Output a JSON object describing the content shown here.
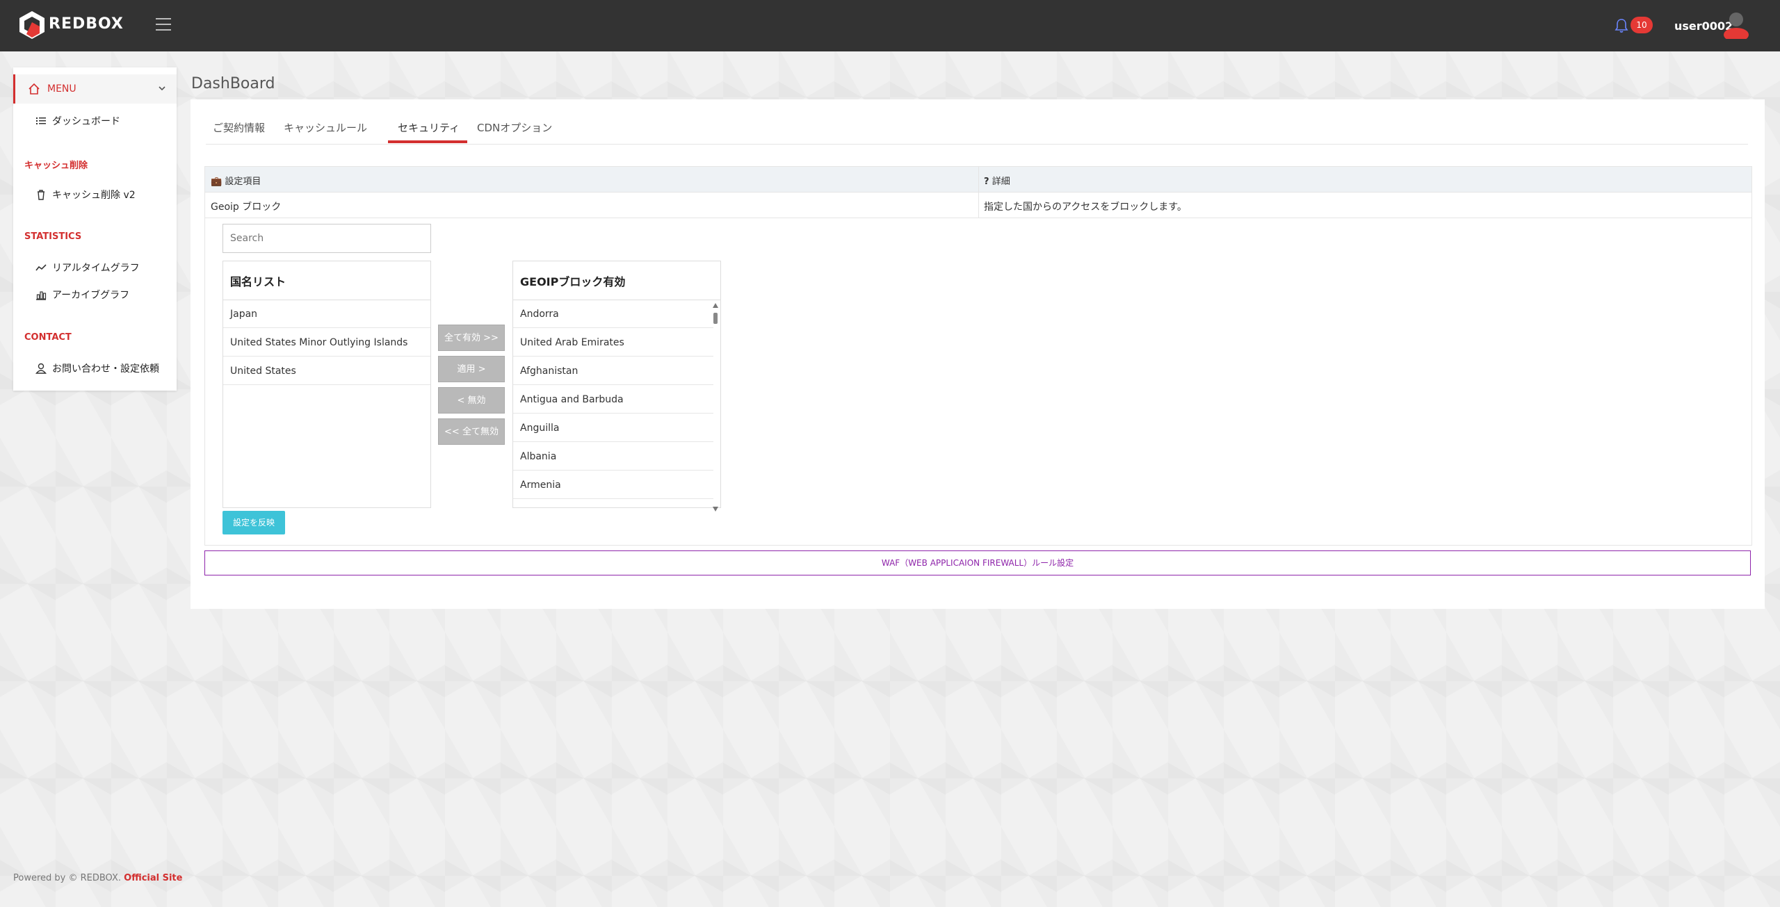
{
  "header": {
    "logo_text": "REDBOX",
    "notification_count": "10",
    "username": "user0002"
  },
  "sidebar": {
    "menu_label": "MENU",
    "items": [
      {
        "label": "ダッシュボード"
      },
      {
        "section": "キャッシュ削除"
      },
      {
        "label": "キャッシュ削除 v2"
      },
      {
        "section": "STATISTICS"
      },
      {
        "label": "リアルタイムグラフ"
      },
      {
        "label": "アーカイブグラフ"
      },
      {
        "section": "CONTACT"
      },
      {
        "label": "お問い合わせ・設定依頼"
      }
    ]
  },
  "main": {
    "title": "DashBoard",
    "tabs": [
      "ご契約情報",
      "キャッシュルール",
      "セキュリティ",
      "CDNオプション"
    ],
    "active_tab": "セキュリティ",
    "table": {
      "col1_header": "設定項目",
      "col2_header": "詳細",
      "row_label": "Geoip ブロック",
      "row_detail": "指定した国からのアクセスをブロックします。"
    },
    "search_placeholder": "Search",
    "left_list": {
      "title": "国名リスト",
      "items": [
        "Japan",
        "United States Minor Outlying Islands",
        "United States"
      ]
    },
    "right_list": {
      "title": "GEOIPブロック有効",
      "items": [
        "Andorra",
        "United Arab Emirates",
        "Afghanistan",
        "Antigua and Barbuda",
        "Anguilla",
        "Albania",
        "Armenia"
      ]
    },
    "buttons": {
      "all_enable": "全て有効 >>",
      "apply": "適用 >",
      "disable": "< 無効",
      "all_disable": "<< 全て無効",
      "reflect": "設定を反映"
    },
    "waf_label": "WAF（WEB APPLICAION FIREWALL）ルール設定"
  },
  "footer": {
    "prefix": "Powered by © REDBOX.",
    "link": "Official Site"
  },
  "colors": {
    "brand_red": "#d32f2f",
    "topbar": "#333333",
    "accent_cyan": "#3ec3d8",
    "waf_purple": "#8e24aa"
  }
}
